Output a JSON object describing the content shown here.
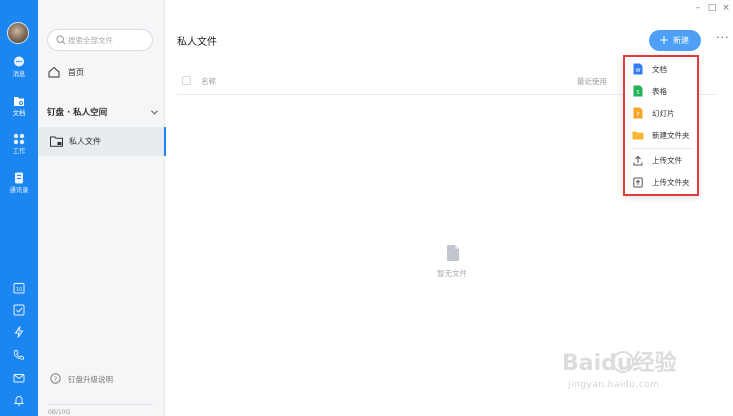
{
  "window": {
    "minimize_glyph": "–",
    "maximize_glyph": "□",
    "close_glyph": "×"
  },
  "rail": {
    "items": [
      {
        "label": "消息",
        "icon": "chat-icon"
      },
      {
        "label": "文档",
        "icon": "documents-icon",
        "active": true
      },
      {
        "label": "工作",
        "icon": "apps-grid-icon"
      },
      {
        "label": "通讯录",
        "icon": "contacts-icon"
      }
    ],
    "tools": [
      "calendar-icon",
      "todo-check-icon",
      "ding-lightning-icon",
      "phone-icon",
      "mail-icon",
      "bell-icon"
    ],
    "calendar_day": "10"
  },
  "sidebar": {
    "search_placeholder": "搜索全部文件",
    "home_label": "首页",
    "space_label": "钉盘 · 私人空间",
    "private_files_label": "私人文件",
    "upgrade_label": "钉盘升级说明",
    "footer_text": "0B/10G"
  },
  "main": {
    "title": "私人文件",
    "new_button_label": "新建",
    "new_button_plus": "+",
    "more_glyph": "···",
    "table": {
      "col_name": "名称",
      "col_recent": "最近使用"
    },
    "empty_text": "暂无文件"
  },
  "menu": {
    "items": [
      {
        "label": "文档",
        "icon": "word-doc-icon",
        "color": "#2f7cf6"
      },
      {
        "label": "表格",
        "icon": "spreadsheet-icon",
        "color": "#20b358"
      },
      {
        "label": "幻灯片",
        "icon": "slides-icon",
        "color": "#f7a526"
      },
      {
        "label": "新建文件夹",
        "icon": "folder-icon",
        "color": "#f7b531"
      },
      {
        "label": "上传文件",
        "icon": "upload-file-icon",
        "color": "#555555"
      },
      {
        "label": "上传文件夹",
        "icon": "upload-folder-icon",
        "color": "#555555"
      }
    ],
    "highlight_color": "#e23b3b"
  },
  "watermark": {
    "logo_text": "Baidu经验",
    "url_text": "jingyan.baidu.com"
  },
  "colors": {
    "rail_blue": "#1b86f0",
    "accent_button": "#4da0f6"
  }
}
